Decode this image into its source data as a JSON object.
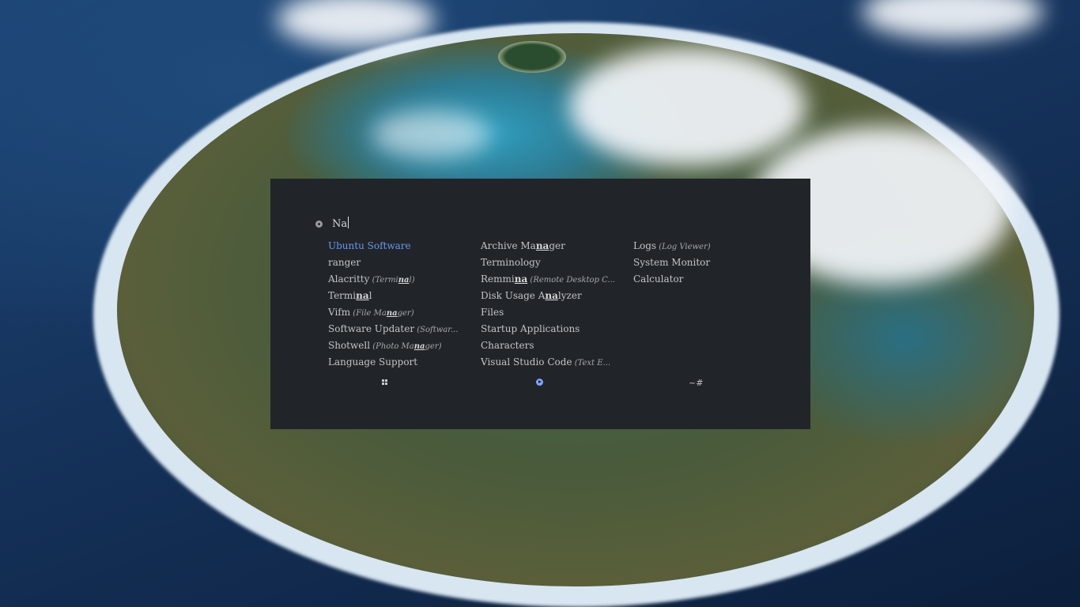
{
  "launcher": {
    "query": "Na",
    "columns": [
      [
        {
          "pre": "Ubuntu Software",
          "match": "",
          "post": "",
          "desc": "",
          "selected": true
        },
        {
          "pre": "ranger",
          "match": "",
          "post": "",
          "desc": ""
        },
        {
          "pre": "Alacritty",
          "match": "",
          "post": "",
          "desc": "(Termi",
          "descMatch": "na",
          "descPost": "l)"
        },
        {
          "pre": "Termi",
          "match": "na",
          "post": "l",
          "desc": ""
        },
        {
          "pre": "Vifm",
          "match": "",
          "post": "",
          "desc": "(File Ma",
          "descMatch": "na",
          "descPost": "ger)"
        },
        {
          "pre": "Software Updater",
          "match": "",
          "post": "",
          "desc": "(Softwar..."
        },
        {
          "pre": "Shotwell",
          "match": "",
          "post": "",
          "desc": "(Photo Ma",
          "descMatch": "na",
          "descPost": "ger)"
        },
        {
          "pre": "Language Support",
          "match": "",
          "post": "",
          "desc": ""
        }
      ],
      [
        {
          "pre": "Archive Ma",
          "match": "na",
          "post": "ger",
          "desc": ""
        },
        {
          "pre": "Terminology",
          "match": "",
          "post": "",
          "desc": ""
        },
        {
          "pre": "Remmi",
          "match": "na",
          "post": "",
          "desc": "(Remote Desktop C..."
        },
        {
          "pre": "Disk Usage A",
          "match": "na",
          "post": "lyzer",
          "desc": ""
        },
        {
          "pre": "Files",
          "match": "",
          "post": "",
          "desc": ""
        },
        {
          "pre": "Startup Applications",
          "match": "",
          "post": "",
          "desc": ""
        },
        {
          "pre": "Characters",
          "match": "",
          "post": "",
          "desc": ""
        },
        {
          "pre": "Visual Studio Code",
          "match": "",
          "post": "",
          "desc": "(Text E..."
        }
      ],
      [
        {
          "pre": "Logs",
          "match": "",
          "post": "",
          "desc": "(Log Viewer)"
        },
        {
          "pre": "System Monitor",
          "match": "",
          "post": "",
          "desc": ""
        },
        {
          "pre": "Calculator",
          "match": "",
          "post": "",
          "desc": ""
        }
      ]
    ],
    "modes": {
      "windows_icon": "window-switcher-icon",
      "run_icon": "run-icon",
      "ssh_label": "~#"
    }
  },
  "colors": {
    "panel_bg": "#21252a",
    "text": "#c3c3c3",
    "selected": "#6f95ea"
  }
}
